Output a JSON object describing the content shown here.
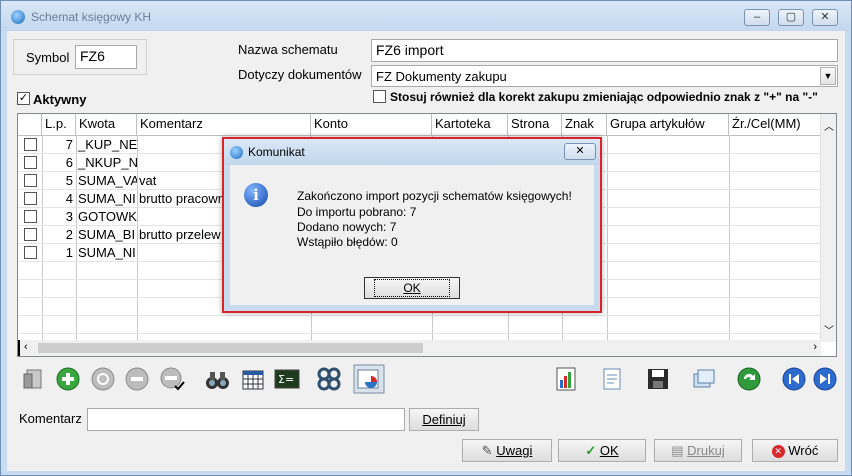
{
  "window": {
    "title": "Schemat księgowy KH"
  },
  "form": {
    "symbol_label": "Symbol",
    "symbol_value": "FZ6",
    "name_label": "Nazwa schematu",
    "name_value": "FZ6 import",
    "docs_label": "Dotyczy dokumentów",
    "docs_value": "FZ Dokumenty zakupu",
    "active_label": "Aktywny",
    "active_checked": true,
    "corrections_label": "Stosuj również dla korekt zakupu zmieniając odpowiednio znak z \"+\" na \"-\"",
    "corrections_checked": false
  },
  "grid": {
    "headers": [
      "L.p.",
      "Kwota",
      "Komentarz",
      "Konto",
      "Kartoteka",
      "Strona",
      "Znak",
      "Grupa artykułów",
      "Źr./Cel(MM)"
    ],
    "rows": [
      {
        "lp": "7",
        "kwota": "_KUP_NE",
        "komentarz": ""
      },
      {
        "lp": "6",
        "kwota": "_NKUP_N",
        "komentarz": ""
      },
      {
        "lp": "5",
        "kwota": "SUMA_VA",
        "komentarz": "vat"
      },
      {
        "lp": "4",
        "kwota": "SUMA_NI",
        "komentarz": "brutto pracown"
      },
      {
        "lp": "3",
        "kwota": "GOTOWK",
        "komentarz": ""
      },
      {
        "lp": "2",
        "kwota": "SUMA_BI",
        "komentarz": "brutto przelew"
      },
      {
        "lp": "1",
        "kwota": "SUMA_NI",
        "komentarz": ""
      }
    ]
  },
  "toolbar_icons": [
    "copy-icon",
    "add-icon",
    "edit-icon",
    "delete-icon",
    "remove-check-icon",
    "binoculars-icon",
    "calendar-grid-icon",
    "formula-icon",
    "settings-gears-icon",
    "chart-window-icon",
    "report-chart-icon",
    "document-icon",
    "save-icon",
    "windows-icon",
    "refresh-icon",
    "first-icon",
    "last-icon"
  ],
  "bottom": {
    "comment_label": "Komentarz",
    "comment_value": "",
    "define_label": "Definiuj",
    "notes_label": "Uwagi",
    "ok_label": "OK",
    "print_label": "Drukuj",
    "back_label": "Wróć"
  },
  "dialog": {
    "title": "Komunikat",
    "lines": [
      "Zakończono import pozycji schematów księgowych!",
      "Do importu pobrano: 7",
      "Dodano nowych: 7",
      "Wstąpiło błędów: 0"
    ],
    "ok_label": "OK"
  }
}
